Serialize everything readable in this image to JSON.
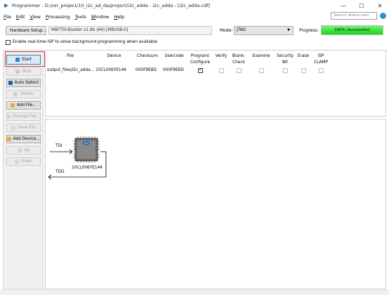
{
  "window": {
    "title": "Programmer - D:/zxr_project/10_i2c_ad_da/project/i2c_adda - i2c_adda - [i2c_adda.cdf]",
    "minimize": "—",
    "maximize": "☐",
    "close": "✕"
  },
  "menu": [
    "File",
    "Edit",
    "View",
    "Processing",
    "Tools",
    "Window",
    "Help"
  ],
  "search": {
    "placeholder": "Search altera.com"
  },
  "toolbar": {
    "hardware_button": "Hardware Setup...",
    "hardware_value": "MBFTDI-Blaster v1.6b (64) [MBUSB-0]",
    "mode_label": "Mode:",
    "mode_value": "JTAG",
    "progress_label": "Progress:",
    "progress_text": "100% (Successful)",
    "progress_fraction": 1.0
  },
  "isp": {
    "label": "Enable real-time ISP to allow background programming when available",
    "checked": false
  },
  "sidebar": {
    "start": "Start",
    "stop": "Stop",
    "auto_detect": "Auto Detect",
    "delete": "Delete",
    "add_file": "Add File...",
    "change_file": "Change File...",
    "save_file": "Save File",
    "add_device": "Add Device...",
    "up": "Up",
    "down": "Down"
  },
  "table": {
    "columns": {
      "file": "File",
      "device": "Device",
      "checksum": "Checksum",
      "usercode": "Usercode",
      "program": "Program/ Configure",
      "verify": "Verify",
      "blank": "Blank- Check",
      "examine": "Examine",
      "security": "Security Bit",
      "erase": "Erase",
      "isp_clamp": "ISP CLAMP"
    },
    "row": {
      "file": "output_files/i2c_adda...",
      "device": "10CL006YE144",
      "checksum": "000F9E8D",
      "usercode": "000F9E8D",
      "program": true,
      "verify": false,
      "blank": false,
      "examine": false,
      "security": false,
      "erase": false,
      "isp_clamp": false
    }
  },
  "chain": {
    "tdi": "TDI",
    "tdo": "TDO",
    "device": "10CL006YE144",
    "chip_logo": "intel"
  }
}
